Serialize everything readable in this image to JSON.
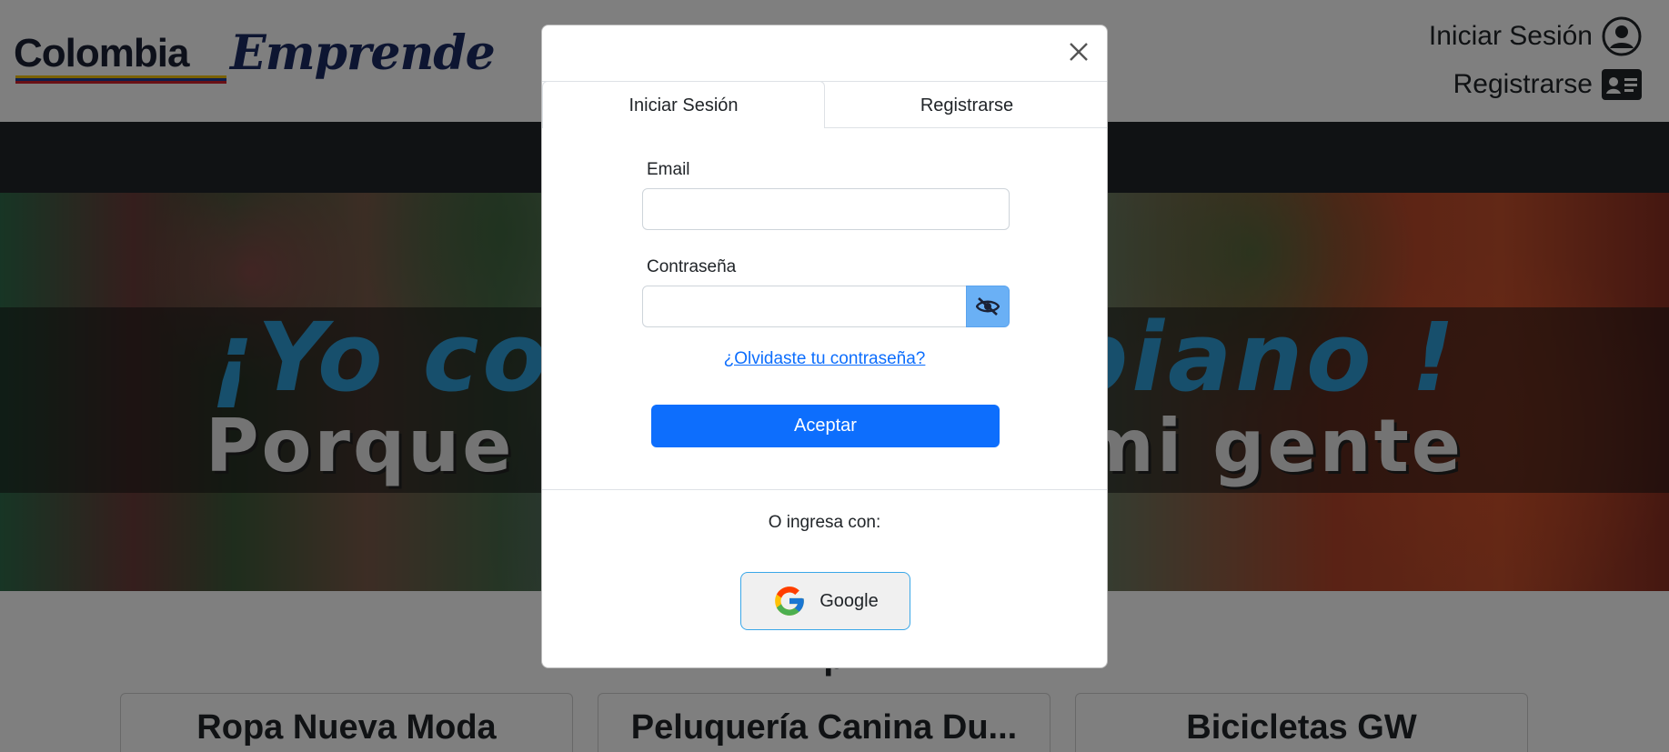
{
  "header": {
    "logo": {
      "part1": "Colombia",
      "part2": "Emprende"
    },
    "login_link": "Iniciar Sesión",
    "register_link": "Registrarse"
  },
  "hero": {
    "title_left": "¡Yo co",
    "title_right": "biano !",
    "subtitle_left": "Porque",
    "subtitle_right": "mi gente"
  },
  "section": {
    "heading_fragment": "p"
  },
  "cards": [
    {
      "title": "Ropa Nueva Moda"
    },
    {
      "title": "Peluquería Canina Du..."
    },
    {
      "title": "Bicicletas GW"
    }
  ],
  "modal": {
    "tabs": {
      "login": "Iniciar Sesión",
      "register": "Registrarse"
    },
    "email_label": "Email",
    "email_value": "",
    "password_label": "Contraseña",
    "password_value": "",
    "forgot_password": "¿Olvidaste tu contraseña?",
    "accept_button": "Aceptar",
    "alt_login_text": "O ingresa con:",
    "google_button": "Google"
  },
  "colors": {
    "primary": "#0d6efd",
    "eye_button": "#6ab0f5",
    "navbar": "#212529",
    "hero_title": "#2f9ed8"
  },
  "icons": {
    "close": "close-icon",
    "user": "user-circle-icon",
    "id_card": "id-card-icon",
    "eye": "eye-slash-icon",
    "google": "google-icon"
  }
}
